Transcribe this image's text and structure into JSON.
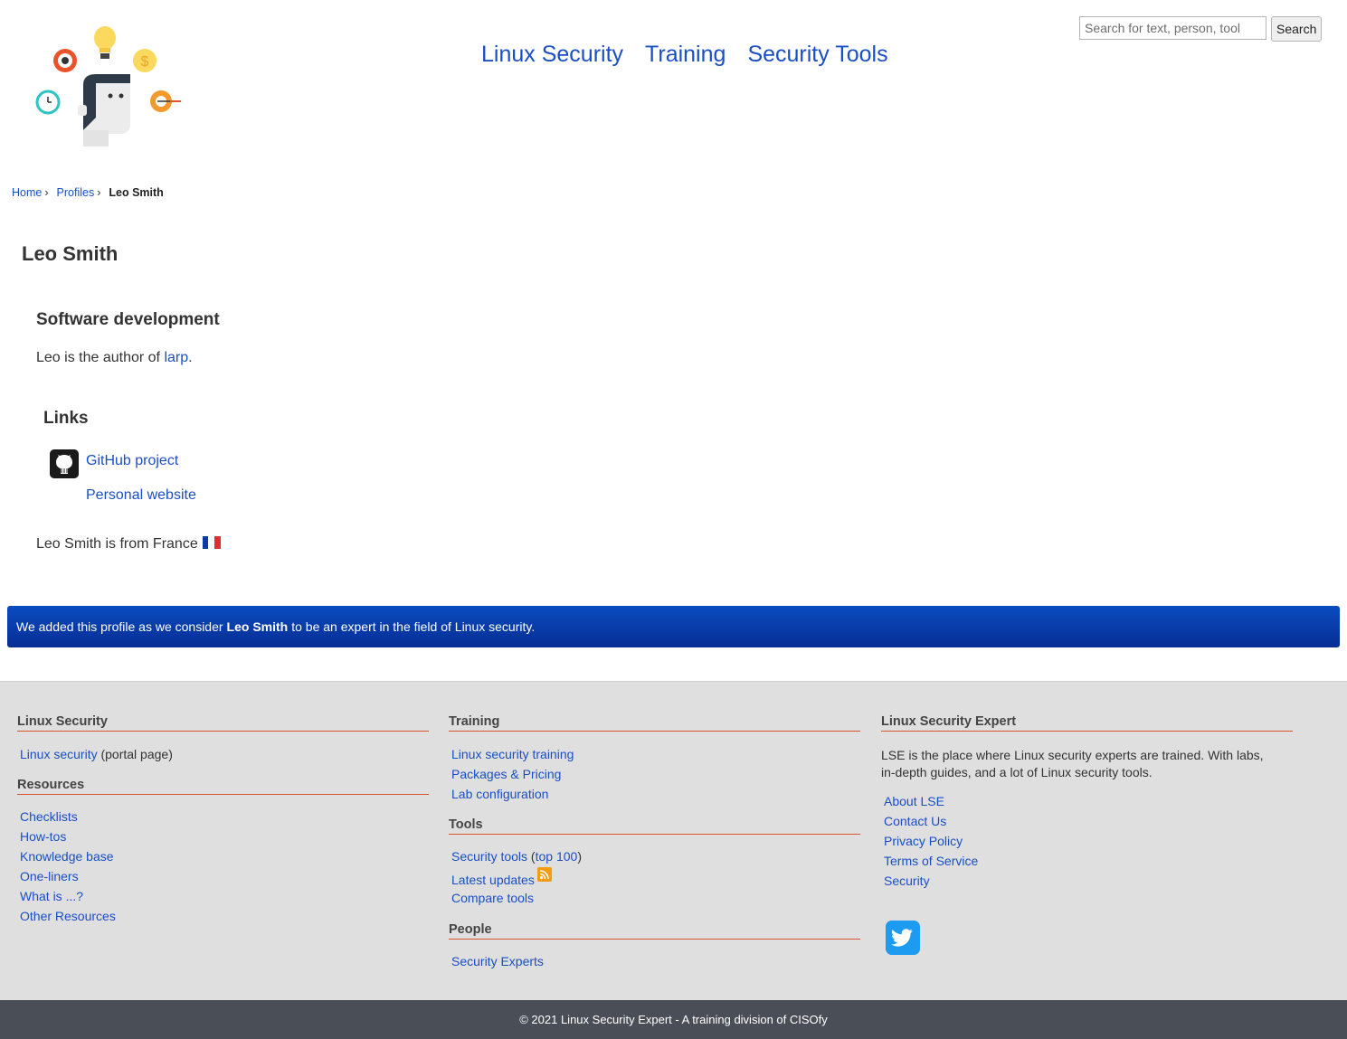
{
  "nav": {
    "items": [
      "Linux Security",
      "Training",
      "Security Tools"
    ]
  },
  "search": {
    "placeholder": "Search for text, person, tool",
    "button_label": "Search"
  },
  "breadcrumb": {
    "home": "Home",
    "profiles": "Profiles",
    "current": "Leo Smith",
    "separator": "›"
  },
  "profile": {
    "name": "Leo Smith",
    "category": "Software development",
    "bio_prefix": "Leo is the author of ",
    "bio_link": "larp",
    "bio_suffix": ".",
    "links_title": "Links",
    "links": [
      "GitHub project",
      "Personal website"
    ],
    "origin_text": "Leo Smith is from France",
    "flag_colors": [
      "#0d39a8",
      "#ffffff",
      "#e32b35"
    ]
  },
  "banner": {
    "prefix": "We added this profile as we consider",
    "name": "Leo Smith",
    "suffix": "to be an expert in the field of Linux security."
  },
  "footer": {
    "col1": {
      "heading": "Linux Security",
      "portal_link": "Linux security",
      "portal_suffix": " (portal page)",
      "resources_heading": "Resources",
      "resources": [
        "Checklists",
        "How-tos",
        "Knowledge base",
        "One-liners",
        "What is ...?",
        "Other Resources"
      ]
    },
    "col2": {
      "heading": "Training",
      "training": [
        "Linux security training",
        "Packages & Pricing",
        "Lab configuration"
      ],
      "tools_heading": "Tools",
      "security_tools": "Security tools",
      "top100_open": " (",
      "top100": "top 100",
      "top100_close": ")",
      "latest_updates": "Latest updates",
      "compare_tools": "Compare tools",
      "people_heading": "People",
      "security_experts": "Security Experts"
    },
    "col3": {
      "heading": "Linux Security Expert",
      "about": "LSE is the place where Linux security experts are trained. With labs, in-depth guides, and a lot of Linux security tools.",
      "links": [
        "About LSE",
        "Contact Us",
        "Privacy Policy",
        "Terms of Service",
        "Security"
      ]
    },
    "copyright": "© 2021 Linux Security Expert - A training division of CISOfy"
  },
  "colors": {
    "link": "#1a4fc4",
    "banner": "#0b4cc0",
    "footer_bg": "#dfdfdf",
    "footer_rule": "#d9542c",
    "copyright_bg": "#4a4e57"
  }
}
